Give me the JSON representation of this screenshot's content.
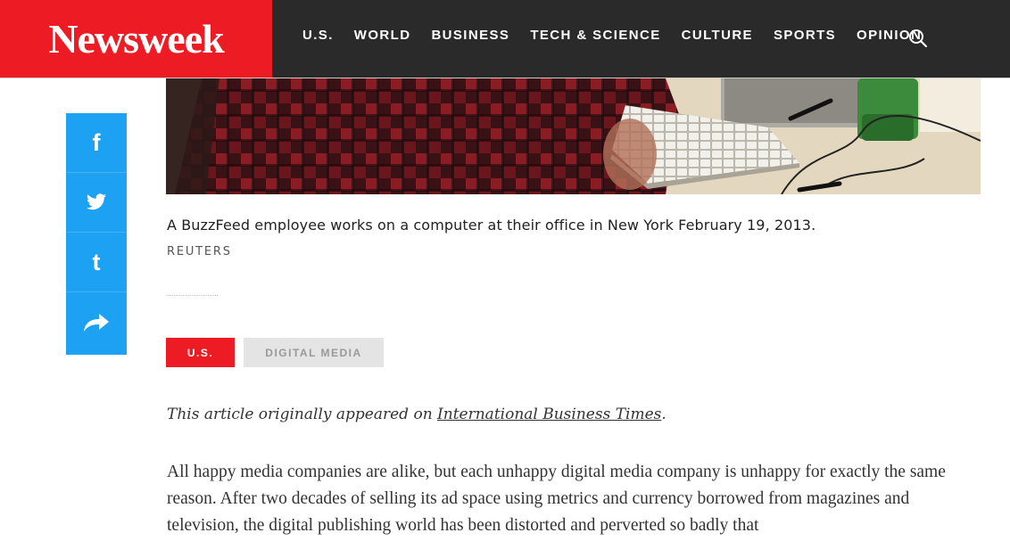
{
  "header": {
    "logo": "Newsweek",
    "nav": [
      "U.S.",
      "WORLD",
      "BUSINESS",
      "TECH & SCIENCE",
      "CULTURE",
      "SPORTS",
      "OPINION"
    ]
  },
  "share": {
    "facebook": "f",
    "twitter": "t",
    "tumblr": "t"
  },
  "caption": "A BuzzFeed employee works on a computer at their office in New York February 19, 2013.",
  "credit": "REUTERS",
  "tags": {
    "primary": "U.S.",
    "secondary": "DIGITAL MEDIA"
  },
  "article": {
    "intro_prefix": "This article originally appeared on ",
    "intro_link": "International Business Times",
    "intro_suffix": ".",
    "paragraph": "All happy media companies are alike, but each unhappy digital media company is unhappy for exactly the same reason. After two decades of selling its ad space using metrics and currency borrowed from magazines and television, the digital publishing world has been distorted and perverted so badly that"
  },
  "colors": {
    "brand_red": "#ed1c24",
    "header_dark": "#2a2a2a",
    "share_blue": "#1da1f2"
  }
}
